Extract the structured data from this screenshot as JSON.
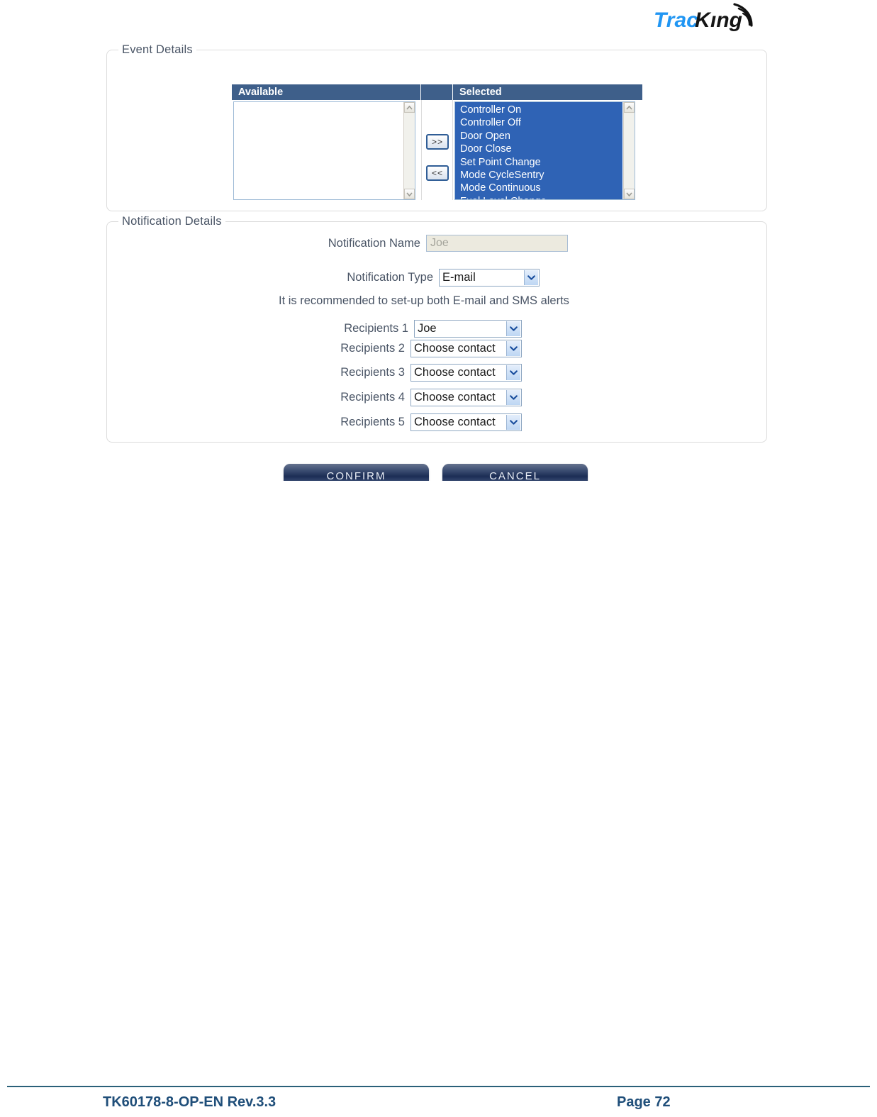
{
  "brand": {
    "logo_text_light": "Trac",
    "logo_text_dark": "King",
    "logo_color_light": "#2196f3",
    "logo_color_dark": "#1a1a1a"
  },
  "event_details": {
    "legend": "Event Details",
    "columns": {
      "available_header": "Available",
      "middle_header": "",
      "selected_header": "Selected"
    },
    "available_items": [],
    "selected_items": [
      "Controller On",
      "Controller Off",
      "Door Open",
      "Door Close",
      "Set Point Change",
      "Mode CycleSentry",
      "Mode Continuous",
      "Fuel Level Change"
    ],
    "move_right_label": ">>",
    "move_left_label": "<<"
  },
  "notification_details": {
    "legend": "Notification Details",
    "name_label": "Notification Name",
    "name_value": "Joe",
    "type_label": "Notification Type",
    "type_value": "E-mail",
    "hint": "It is recommended to set-up both E-mail and SMS alerts",
    "recipients": [
      {
        "label": "Recipients 1",
        "value": "Joe"
      },
      {
        "label": "Recipients 2",
        "value": "Choose contact"
      },
      {
        "label": "Recipients 3",
        "value": "Choose contact"
      },
      {
        "label": "Recipients 4",
        "value": "Choose contact"
      },
      {
        "label": "Recipients 5",
        "value": "Choose contact"
      }
    ]
  },
  "actions": {
    "confirm_label": "CONFIRM",
    "cancel_label": "CANCEL"
  },
  "footer": {
    "document_id": "TK60178-8-OP-EN Rev.3.3",
    "page_label": "Page  72"
  },
  "colors": {
    "list_header_bg": "#3e5f8a",
    "list_selection_bg": "#2f63b5",
    "footer_text": "#1f4e79",
    "panel_border": "#dcdcdc"
  }
}
